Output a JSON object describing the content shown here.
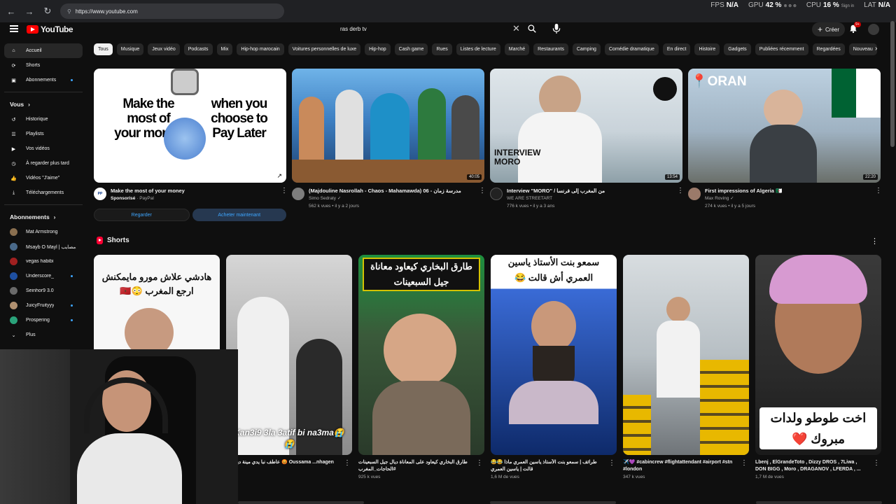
{
  "browser": {
    "url": "https://www.youtube.com",
    "stats": [
      {
        "label": "FPS",
        "value": "N/A",
        "extra": ""
      },
      {
        "label": "GPU",
        "value": "42 %",
        "extra": "⊗ ⊗ ⊗"
      },
      {
        "label": "CPU",
        "value": "16 %",
        "extra": "Sign in"
      },
      {
        "label": "LAT",
        "value": "N/A",
        "extra": ""
      }
    ]
  },
  "header": {
    "logo_text": "YouTube",
    "search_value": "ras derb tv",
    "create_label": "Créer",
    "notif_badge": "9+"
  },
  "sidebar": {
    "main": [
      {
        "label": "Accueil",
        "icon": "home-icon",
        "active": true,
        "dot": false
      },
      {
        "label": "Shorts",
        "icon": "shorts-icon",
        "active": false,
        "dot": false
      },
      {
        "label": "Abonnements",
        "icon": "subscriptions-icon",
        "active": false,
        "dot": true
      }
    ],
    "you_heading": "Vous",
    "you": [
      {
        "label": "Historique",
        "icon": "history-icon"
      },
      {
        "label": "Playlists",
        "icon": "playlists-icon"
      },
      {
        "label": "Vos vidéos",
        "icon": "your-videos-icon"
      },
      {
        "label": "À regarder plus tard",
        "icon": "watch-later-icon"
      },
      {
        "label": "Vidéos \"J'aime\"",
        "icon": "liked-icon"
      },
      {
        "label": "Téléchargements",
        "icon": "downloads-icon"
      }
    ],
    "subs_heading": "Abonnements",
    "subs": [
      {
        "label": "Mat Armstrong",
        "color": "#8a6f4f",
        "dot": false
      },
      {
        "label": "Msayb O Mayl | مصايب...",
        "color": "#4a6a8a",
        "dot": false
      },
      {
        "label": "vegas habibi",
        "color": "#a02020",
        "dot": false
      },
      {
        "label": "Underscore_",
        "color": "#1e4fa0",
        "dot": true
      },
      {
        "label": "Seinhor9 3.0",
        "color": "#6a6a6a",
        "dot": false
      },
      {
        "label": "JuicyFruityyy",
        "color": "#b09070",
        "dot": true
      },
      {
        "label": "Prospering",
        "color": "#2aa37a",
        "dot": true
      }
    ],
    "more_label": "Plus"
  },
  "chips": [
    "Tous",
    "Musique",
    "Jeux vidéo",
    "Podcasts",
    "Mix",
    "Hip-hop marocain",
    "Voitures personnelles de luxe",
    "Hip-hop",
    "Cash game",
    "Rues",
    "Listes de lecture",
    "Marché",
    "Restaurants",
    "Camping",
    "Comédie dramatique",
    "En direct",
    "Histoire",
    "Gadgets",
    "Publiées récemment",
    "Regardées",
    "Nouveau"
  ],
  "ad": {
    "thumb_left": "Make the most of your money",
    "thumb_right": "when you choose to Pay Later",
    "title": "Make the most of your money",
    "sponsor": "Sponsorisé",
    "advertiser": "PayPal",
    "watch_label": "Regarder",
    "buy_label": "Acheter maintenant"
  },
  "videos": [
    {
      "title": "(Majdouline Nasrollah - Chaos - Mahamawda) 06 - مدرسة زمان",
      "channel": "Simo Sedraty ✓",
      "stats": "562 k vues • il y a 2 jours",
      "duration": "40:05",
      "thumb_text": ""
    },
    {
      "title": "Interview \"MORO\" / من المغرب إلى فرنسا",
      "channel": "WE ARE STREETART",
      "stats": "776 k vues • il y a 3 ans",
      "duration": "13:54",
      "thumb_text": "INTERVIEW MORO"
    },
    {
      "title": "First impressions of Algeria 🇩🇿",
      "channel": "Max Roving ✓",
      "stats": "274 k vues • il y a 5 jours",
      "duration": "22:20",
      "thumb_text": "📍ORAN"
    }
  ],
  "shorts_heading": "Shorts",
  "shorts": [
    {
      "caption": "هادشي علاش مورو مايمكنش ارجع المغرب 😳🇲🇦",
      "title": "",
      "views": ""
    },
    {
      "caption": "Kan3i9 3la 3atif bi na3ma😭😭",
      "title": "عاطف نبا يدي مينة ديال كو 😡 Oussama ...nhagen",
      "views": "vues"
    },
    {
      "caption": "طارق البخاري كيعاود معاناة جيل السبعينات",
      "title": "طارق البخاري كيعاود على المعاناة ديال جيل السبعينات #الحاجات_المغرب",
      "views": "925 k vues"
    },
    {
      "caption": "سمعو بنت الأستاذ ياسين العمري أش قالت 😂",
      "title": "😂😂 طرائف | سمعو بنت الأستاذ ياسين العمري ماذا قالت | ياسين العمري",
      "views": "1,6 M de vues"
    },
    {
      "caption": "",
      "title": "✈️💜 #cabincrew #flightattendant #airport #stn #london",
      "views": "347 k vues"
    },
    {
      "caption": "اخت طوطو ولدات مبروك ❤️",
      "title": "Lbenj , ElGrandeToto , Dizzy DROS , 7Liwa , DON BIGG , Moro , DRAGANOV , LFERDA , ...",
      "views": "1,7 M de vues"
    }
  ]
}
